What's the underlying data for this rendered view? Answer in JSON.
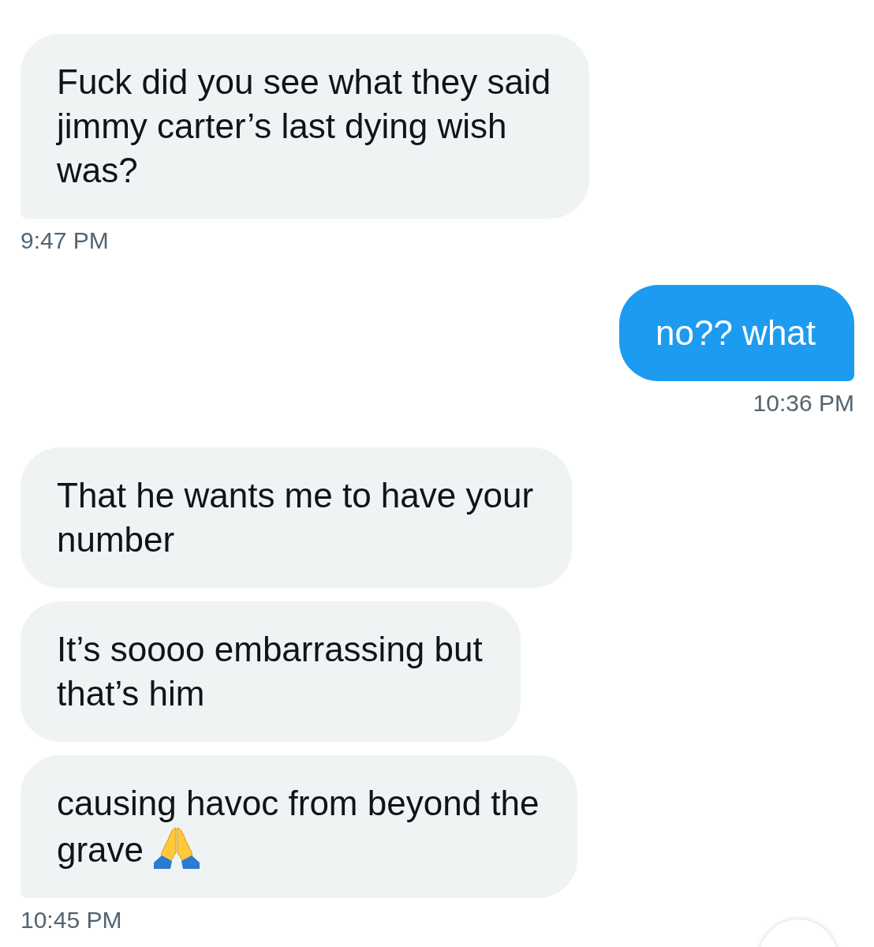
{
  "conversation": [
    {
      "kind": "received",
      "messages": [
        {
          "text": "Fuck did you see what they said jimmy carter’s last dying wish was?",
          "trailing_emoji": false
        }
      ],
      "time": "9:47 PM"
    },
    {
      "kind": "sent",
      "messages": [
        {
          "text": "no?? what",
          "trailing_emoji": false
        }
      ],
      "time": "10:36 PM"
    },
    {
      "kind": "received",
      "messages": [
        {
          "text": "That he wants me to have your number",
          "trailing_emoji": false
        },
        {
          "text": "It’s soooo embarrassing but that’s him",
          "trailing_emoji": false
        },
        {
          "text": "causing havoc from beyond the grave",
          "trailing_emoji": true
        }
      ],
      "time": "10:45 PM"
    }
  ]
}
